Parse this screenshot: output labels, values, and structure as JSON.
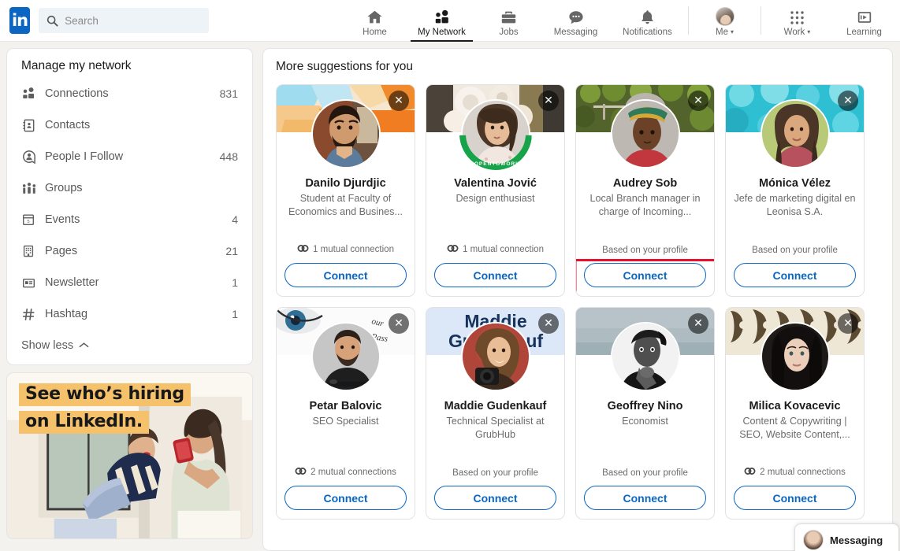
{
  "header": {
    "logo_text": "in",
    "search": {
      "placeholder": "Search",
      "value": "",
      "icon": "search-icon"
    },
    "nav": [
      {
        "label": "Home",
        "icon": "home-icon",
        "active": false
      },
      {
        "label": "My Network",
        "icon": "my-network-icon",
        "active": true
      },
      {
        "label": "Jobs",
        "icon": "jobs-briefcase-icon",
        "active": false
      },
      {
        "label": "Messaging",
        "icon": "messaging-chat-icon",
        "active": false
      },
      {
        "label": "Notifications",
        "icon": "notifications-bell-icon",
        "active": false
      },
      {
        "label": "Me",
        "icon": "me-avatar-icon",
        "active": false,
        "caret": "▾"
      },
      {
        "label": "Work",
        "icon": "work-grid-icon",
        "active": false,
        "caret": "▾"
      },
      {
        "label": "Learning",
        "icon": "learning-icon",
        "active": false
      }
    ]
  },
  "sidebar": {
    "title": "Manage my network",
    "items": [
      {
        "label": "Connections",
        "count": "831",
        "icon": "connections-icon"
      },
      {
        "label": "Contacts",
        "count": "",
        "icon": "contacts-book-icon"
      },
      {
        "label": "People I Follow",
        "count": "448",
        "icon": "people-follow-icon"
      },
      {
        "label": "Groups",
        "count": "",
        "icon": "groups-icon"
      },
      {
        "label": "Events",
        "count": "4",
        "icon": "events-calendar-icon"
      },
      {
        "label": "Pages",
        "count": "21",
        "icon": "pages-building-icon"
      },
      {
        "label": "Newsletter",
        "count": "1",
        "icon": "newsletter-icon"
      },
      {
        "label": "Hashtag",
        "count": "1",
        "icon": "hashtag-icon"
      }
    ],
    "show_less": "Show less",
    "promo": {
      "line1": "See who’s hiring",
      "line2": "on LinkedIn.",
      "highlight_color": "#f5c26b"
    }
  },
  "main": {
    "title": "More suggestions for you",
    "connect_label": "Connect",
    "dismiss_icon": "close-x-icon",
    "accent_color": "#0a66c2",
    "highlight_color": "#e8112d",
    "cards": [
      {
        "name": "Danilo Djurdjic",
        "headline": "Student at Faculty of Economics and Busines...",
        "meta": "1 mutual connection",
        "meta_type": "mutual",
        "open_to_work": false,
        "highlighted": false,
        "cover_style": "abstract-teal-orange"
      },
      {
        "name": "Valentina Jović",
        "headline": "Design enthusiast",
        "meta": "1 mutual connection",
        "meta_type": "mutual",
        "open_to_work": true,
        "open_to_work_text": "#OPENTOWORK",
        "highlighted": false,
        "cover_style": "cream-flowers"
      },
      {
        "name": "Audrey Sob",
        "headline": "Local Branch manager in charge of Incoming...",
        "meta": "Based on your profile",
        "meta_type": "profile",
        "open_to_work": false,
        "highlighted": true,
        "cover_style": "green-foliage"
      },
      {
        "name": "Mónica Vélez",
        "headline": "Jefe de marketing digital en Leonisa S.A.",
        "meta": "Based on your profile",
        "meta_type": "profile",
        "open_to_work": false,
        "highlighted": false,
        "cover_style": "turquoise-water"
      },
      {
        "name": "Petar Balovic",
        "headline": "SEO Specialist",
        "meta": "2 mutual connections",
        "meta_type": "mutual",
        "open_to_work": false,
        "highlighted": false,
        "cover_style": "eye-white"
      },
      {
        "name": "Maddie Gudenkauf",
        "headline": "Technical Specialist at GrubHub",
        "meta": "Based on your profile",
        "meta_type": "profile",
        "open_to_work": false,
        "highlighted": false,
        "cover_style": "lightblue-nametext",
        "cover_text": "Maddie Gudenkauf"
      },
      {
        "name": "Geoffrey Nino",
        "headline": "Economist",
        "meta": "Based on your profile",
        "meta_type": "profile",
        "open_to_work": false,
        "highlighted": false,
        "cover_style": "slate-gray"
      },
      {
        "name": "Milica Kovacevic",
        "headline": "Content & Copywriting | SEO, Website Content,...",
        "meta": "2 mutual connections",
        "meta_type": "mutual",
        "open_to_work": false,
        "highlighted": false,
        "cover_style": "ornate-pattern"
      }
    ]
  },
  "messaging_widget": {
    "label": "Messaging",
    "avatar": "user-avatar-icon"
  }
}
